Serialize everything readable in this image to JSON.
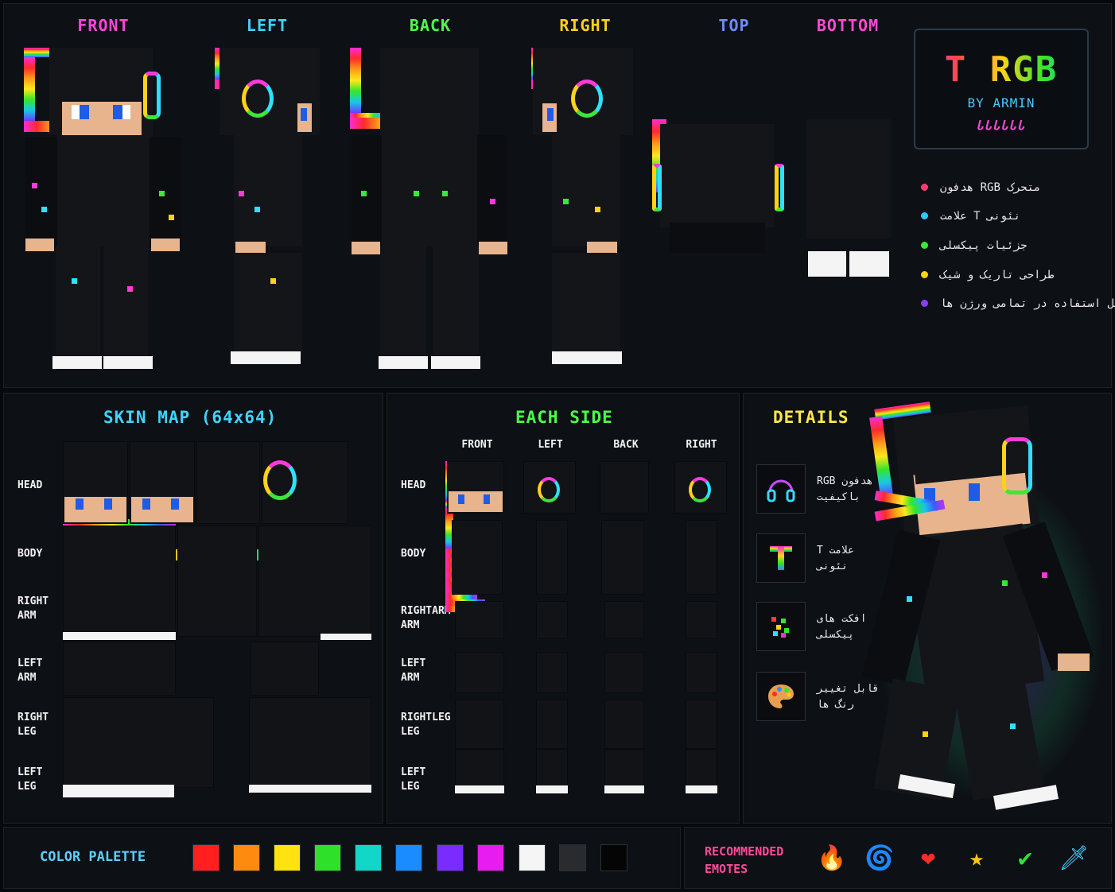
{
  "views": [
    {
      "label": "FRONT",
      "color": "#ff45d9"
    },
    {
      "label": "LEFT",
      "color": "#3fd4ff"
    },
    {
      "label": "BACK",
      "color": "#4dff4a"
    },
    {
      "label": "RIGHT",
      "color": "#ffd21a"
    },
    {
      "label": "TOP",
      "color": "#6e8cff"
    },
    {
      "label": "BOTTOM",
      "color": "#ff4ad0"
    }
  ],
  "brand": {
    "title": "T RGB",
    "subtitle": "BY ARMIN",
    "signature": "ᏓᏓᏓᏓᏓᏓ"
  },
  "features": [
    {
      "text": "هدفون RGB متحرک",
      "color": "#ff3b6f"
    },
    {
      "text": "علامت T نئونی",
      "color": "#2fc8ff"
    },
    {
      "text": "جزئیات پیکسلی",
      "color": "#3ce63a"
    },
    {
      "text": "طراحی تاریک و شیک",
      "color": "#ffd21a"
    },
    {
      "text": "قابل استفاده در تمامی ورژن ها",
      "color": "#8a3cff"
    }
  ],
  "skin_map": {
    "title": "SKIN MAP (64x64)",
    "title_color": "#3fd4ff",
    "rows": [
      "HEAD",
      "BODY",
      "RIGHT ARM",
      "LEFT ARM",
      "RIGHT LEG",
      "LEFT LEG"
    ]
  },
  "each_side": {
    "title": "EACH SIDE",
    "title_color": "#4dff4a",
    "columns": [
      "FRONT",
      "LEFT",
      "BACK",
      "RIGHT"
    ],
    "rows": [
      "HEAD",
      "BODY",
      "RIGHTARM ARM",
      "LEFT ARM",
      "RIGHTLEG LEG",
      "LEFT LEG"
    ]
  },
  "details": {
    "title": "DETAILS",
    "title_color": "#ffe84a",
    "items": [
      {
        "text": "RGB هدفون باکیفیت",
        "icon": "headphones-icon"
      },
      {
        "text": "T علامت نئونی",
        "icon": "t-letter-icon"
      },
      {
        "text": "افکت های پیکسلی",
        "icon": "pixel-effect-icon"
      },
      {
        "text": "قابل تغییر رنگ ها",
        "icon": "palette-icon"
      }
    ]
  },
  "palette": {
    "label": "COLOR PALETTE",
    "label_color": "#5ad0ff",
    "colors": [
      "#ff1f1f",
      "#ff8a10",
      "#ffe20f",
      "#2fe02a",
      "#12d6c8",
      "#1a8cff",
      "#7a2cff",
      "#e61cf0",
      "#f5f5f5",
      "#2a2b2e",
      "#050506"
    ]
  },
  "emotes": {
    "label": "RECOMMENDED EMOTES",
    "label_color": "#ff4a9a",
    "items": [
      {
        "icon": "blue-flame-icon",
        "glyph": "🔥",
        "color": "#2f8cff"
      },
      {
        "icon": "spiral-icon",
        "glyph": "🌀",
        "color": "#ff4ad0"
      },
      {
        "icon": "heart-icon",
        "glyph": "❤",
        "color": "#ff2a2a"
      },
      {
        "icon": "star-icon",
        "glyph": "★",
        "color": "#ffc21a"
      },
      {
        "icon": "check-icon",
        "glyph": "✔",
        "color": "#2fe03a"
      },
      {
        "icon": "sword-icon",
        "glyph": "🗡",
        "color": "#3fd4ff"
      }
    ]
  }
}
